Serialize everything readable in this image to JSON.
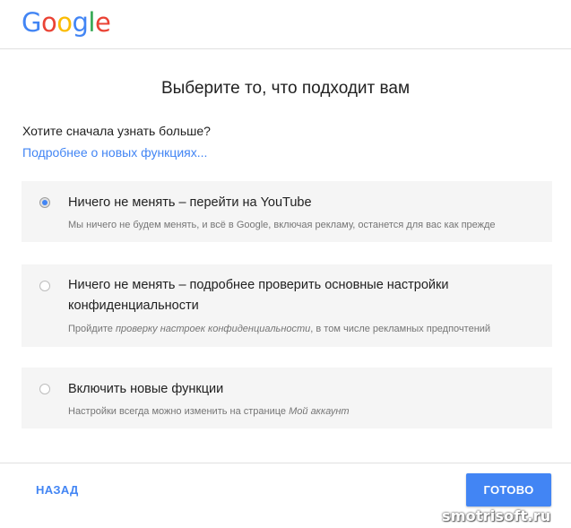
{
  "header": {
    "logo": {
      "letters": [
        "G",
        "o",
        "o",
        "g",
        "l",
        "e"
      ],
      "colors": [
        "#4285f4",
        "#ea4335",
        "#fbbc05",
        "#4285f4",
        "#34a853",
        "#ea4335"
      ]
    }
  },
  "main": {
    "title": "Выберите то, что подходит вам",
    "question": "Хотите сначала узнать больше?",
    "learn_more_link": "Подробнее о новых функциях...",
    "options": [
      {
        "title": "Ничего не менять – перейти на YouTube",
        "description": "Мы ничего не будем менять, и всё в Google, включая рекламу, останется для вас как прежде",
        "checked": true
      },
      {
        "title": "Ничего не менять – подробнее проверить основные настройки конфиденциальности",
        "description_prefix": "Пройдите ",
        "description_italic": "проверку настроек конфиденциальности",
        "description_suffix": ", в том числе рекламных предпочтений",
        "checked": false
      },
      {
        "title": "Включить новые функции",
        "description_prefix": "Настройки всегда можно изменить на странице ",
        "description_italic": "Мой аккаунт",
        "checked": false
      }
    ]
  },
  "footer": {
    "back_label": "НАЗАД",
    "done_label": "ГОТОВО"
  },
  "watermark": "smotrisoft.ru",
  "colors": {
    "accent": "#4285f4",
    "option_bg": "#f5f5f5"
  }
}
